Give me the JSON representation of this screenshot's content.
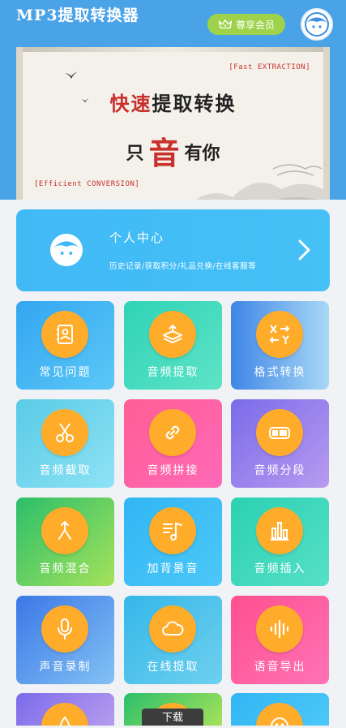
{
  "header": {
    "title": "MP3提取转换器",
    "vip_label": "尊享会员"
  },
  "banner": {
    "tag_top": "[Fast EXTRACTION]",
    "line1_red": "快速",
    "line1_rest": "提取转换",
    "line2_a": "只",
    "line2_big": "音",
    "line2_b": "有你",
    "tag_bottom": "[Efficient CONVERSION]"
  },
  "personal": {
    "title": "个人中心",
    "subtitle": "历史记录/获取积分/礼品兑换/在线客服等"
  },
  "tiles": [
    {
      "label": "常见问题",
      "icon": "contacts-icon"
    },
    {
      "label": "音频提取",
      "icon": "layers-icon"
    },
    {
      "label": "格式转换",
      "icon": "xy-convert-icon"
    },
    {
      "label": "音频截取",
      "icon": "scissors-icon"
    },
    {
      "label": "音频拼接",
      "icon": "link-icon"
    },
    {
      "label": "音频分段",
      "icon": "battery-segment-icon"
    },
    {
      "label": "音频混合",
      "icon": "merge-icon"
    },
    {
      "label": "加背景音",
      "icon": "music-list-icon"
    },
    {
      "label": "音频插入",
      "icon": "equalizer-icon"
    },
    {
      "label": "声音录制",
      "icon": "microphone-icon"
    },
    {
      "label": "在线提取",
      "icon": "cloud-icon"
    },
    {
      "label": "语音导出",
      "icon": "voice-wave-icon"
    }
  ],
  "download_label": "下载",
  "colors": {
    "header_bg": "#4aa3e6",
    "circle": "#ffac2b",
    "banner_red": "#c9302c"
  }
}
